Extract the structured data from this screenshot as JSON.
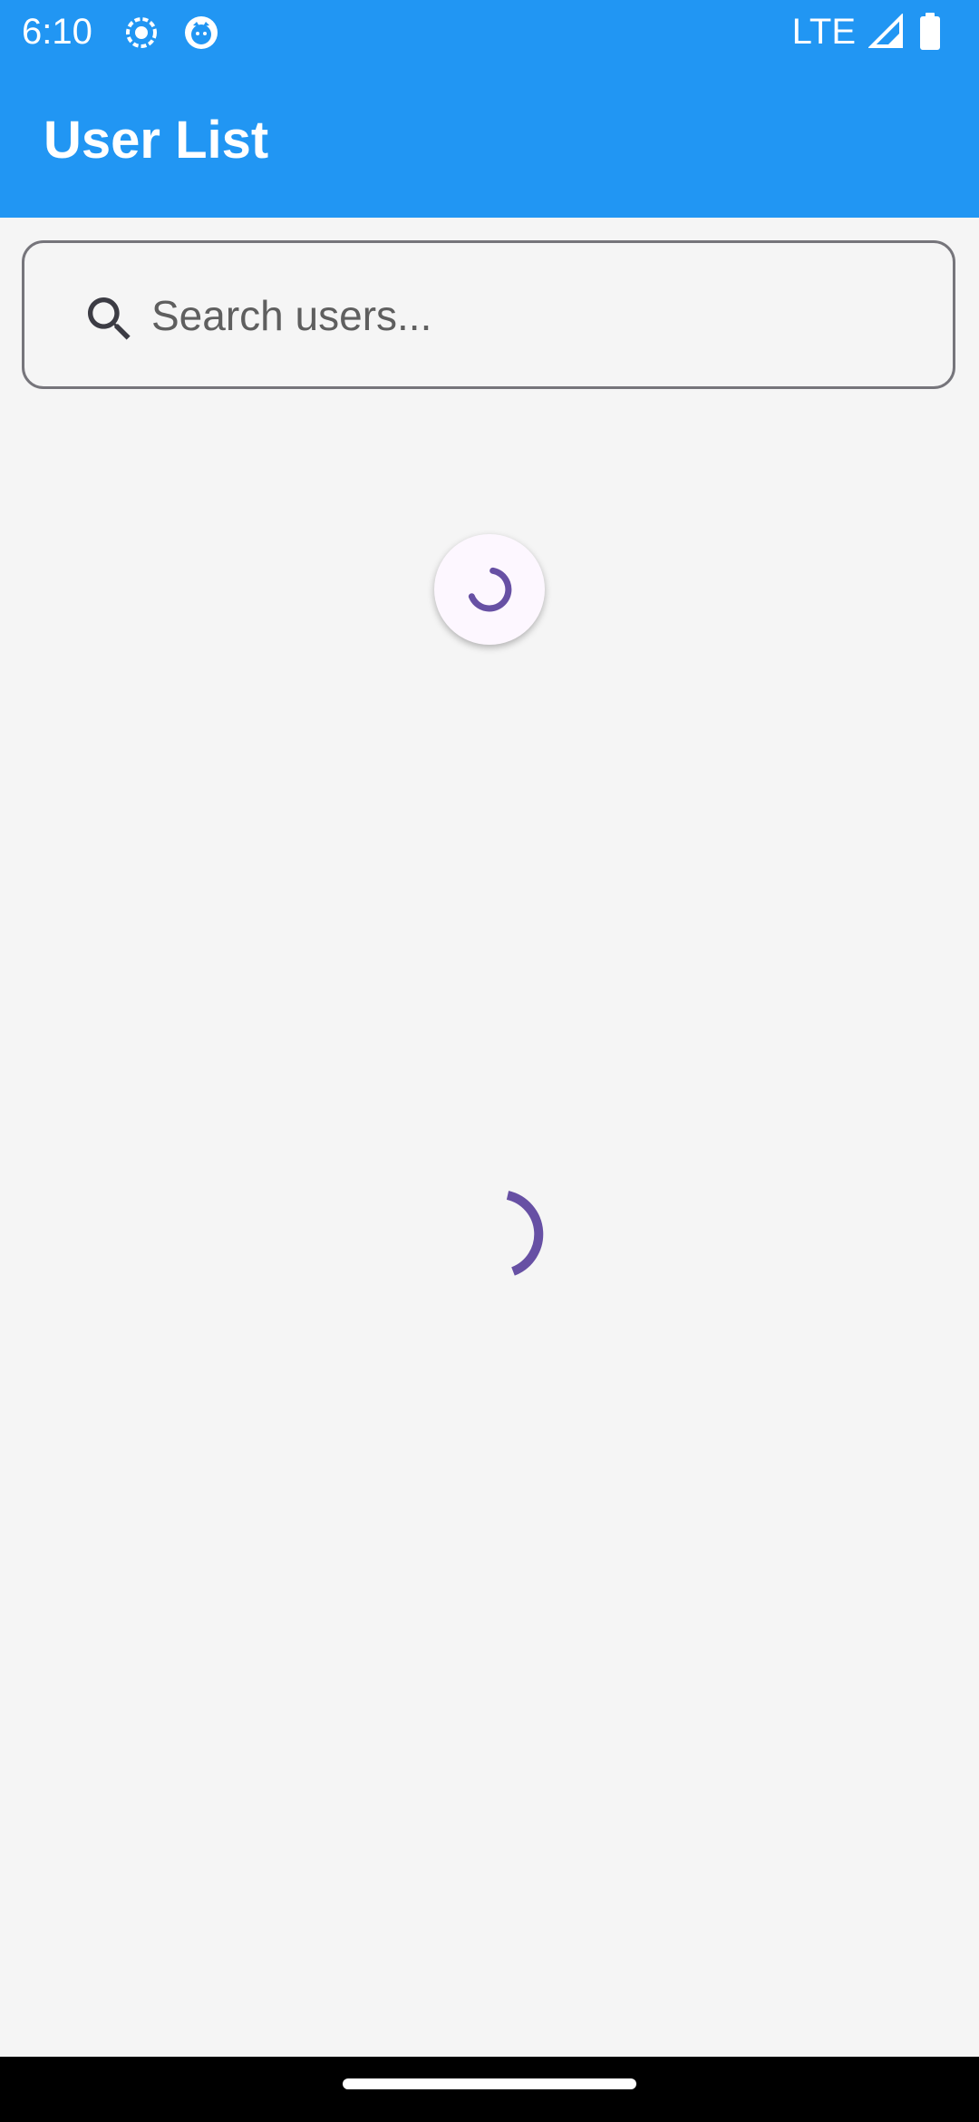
{
  "status_bar": {
    "time": "6:10",
    "network": "LTE",
    "background_color": "#2196f3",
    "icons": [
      "screen-record-icon",
      "notification-app-icon",
      "signal-icon",
      "battery-icon"
    ]
  },
  "app_bar": {
    "title": "User List",
    "background_color": "#2196f3"
  },
  "search": {
    "placeholder": "Search users...",
    "value": "",
    "icon": "search-icon"
  },
  "loading": {
    "pull_to_refresh_active": true,
    "content_loading": true,
    "spinner_color": "#6750a4"
  },
  "colors": {
    "background": "#f5f5f5",
    "accent": "#6750a4",
    "outline": "#76757b"
  }
}
